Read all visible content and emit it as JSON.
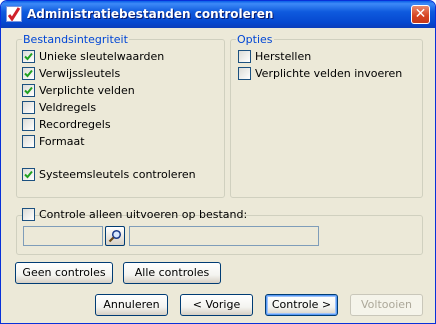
{
  "window": {
    "title": "Administratiebestanden controleren"
  },
  "integrity": {
    "legend": "Bestandsintegriteit",
    "items": [
      {
        "label": "Unieke sleutelwaarden",
        "checked": true
      },
      {
        "label": "Verwijssleutels",
        "checked": true
      },
      {
        "label": "Verplichte velden",
        "checked": true
      },
      {
        "label": "Veldregels",
        "checked": false
      },
      {
        "label": "Recordregels",
        "checked": false
      },
      {
        "label": "Formaat",
        "checked": false
      }
    ],
    "system_keys": {
      "label": "Systeemsleutels controleren",
      "checked": true
    }
  },
  "options": {
    "legend": "Opties",
    "items": [
      {
        "label": "Herstellen",
        "checked": false
      },
      {
        "label": "Verplichte velden invoeren",
        "checked": false
      }
    ]
  },
  "file_check": {
    "label": "Controle alleen uitvoeren op bestand:",
    "checked": false,
    "code_value": "",
    "name_value": ""
  },
  "buttons": {
    "none_label": "Geen controles",
    "all_label": "Alle controles",
    "cancel_label": "Annuleren",
    "prev_label": "< Vorige",
    "next_label": "Controle >",
    "finish_label": "Voltooien"
  },
  "icons": {
    "close": "close-icon",
    "search": "search-icon",
    "app": "checkmark-app-icon"
  },
  "colors": {
    "title_bar": "#0a5fe8",
    "legend": "#0046d5",
    "check": "#21a121"
  }
}
